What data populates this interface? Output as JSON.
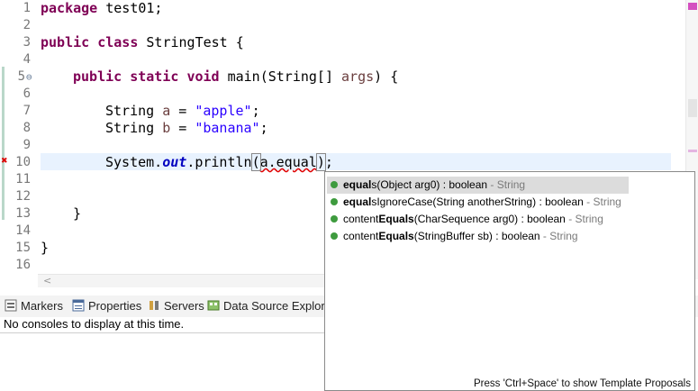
{
  "editor": {
    "line_numbers": [
      "1",
      "2",
      "3",
      "4",
      "5",
      "6",
      "7",
      "8",
      "9",
      "10",
      "11",
      "12",
      "13",
      "14",
      "15",
      "16"
    ],
    "collapse_marker": "⊖",
    "code": {
      "l1_kw": "package",
      "l1_rest": " test01;",
      "l3_kw1": "public",
      "l3_kw2": "class",
      "l3_rest": " StringTest {",
      "l5_kw1": "public",
      "l5_kw2": "static",
      "l5_kw3": "void",
      "l5_mid": " main(String[] ",
      "l5_var": "args",
      "l5_end": ") {",
      "l7_type": "String ",
      "l7_var": "a",
      "l7_eq": " = ",
      "l7_str": "\"apple\"",
      "l7_end": ";",
      "l8_type": "String ",
      "l8_var": "b",
      "l8_eq": " = ",
      "l8_str": "\"banana\"",
      "l8_end": ";",
      "l10_a": "System.",
      "l10_out": "out",
      "l10_b": ".println",
      "l10_paren": "(",
      "l10_expr": "a.equal",
      "l10_close": ")",
      "l10_end": ";",
      "l13": "}",
      "l15": "}"
    }
  },
  "bottom_tabs": [
    {
      "label": "Markers",
      "icon": "markers-icon"
    },
    {
      "label": "Properties",
      "icon": "properties-icon"
    },
    {
      "label": "Servers",
      "icon": "servers-icon"
    },
    {
      "label": "Data Source Explore",
      "icon": "data-source-icon"
    }
  ],
  "console": {
    "message": "No consoles to display at this time."
  },
  "proposals": {
    "items": [
      {
        "bold": "equal",
        "rest": "s(Object arg0) : boolean",
        "owner": " - String"
      },
      {
        "bold": "equal",
        "rest": "sIgnoreCase(String anotherString) : boolean",
        "owner": " - String"
      },
      {
        "pre": "content",
        "bold": "Equals",
        "rest": "(CharSequence arg0) : boolean",
        "owner": " - String"
      },
      {
        "pre": "content",
        "bold": "Equals",
        "rest": "(StringBuffer sb) : boolean",
        "owner": " - String"
      }
    ],
    "footer": "Press 'Ctrl+Space' to show Template Proposals"
  },
  "colors": {
    "keyword": "#7f0055",
    "string": "#2a00ff",
    "static_field": "#0000c0",
    "method_icon": "#3e9b3e"
  }
}
